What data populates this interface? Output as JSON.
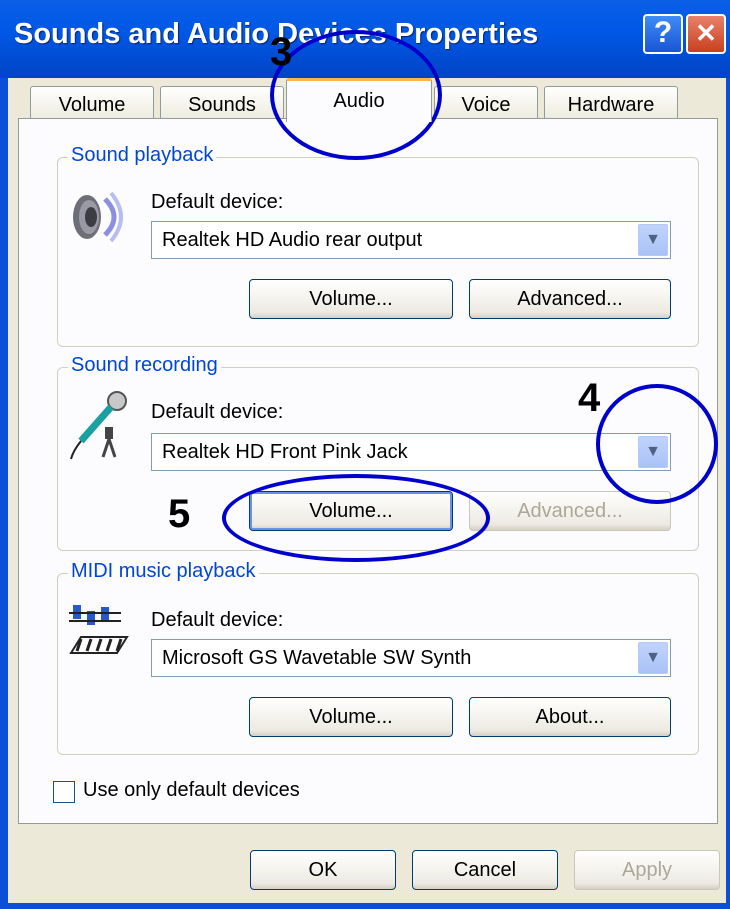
{
  "window": {
    "title": "Sounds and Audio Devices Properties",
    "help_glyph": "?",
    "close_glyph": "✕"
  },
  "tabs": [
    {
      "label": "Volume"
    },
    {
      "label": "Sounds"
    },
    {
      "label": "Audio",
      "active": true
    },
    {
      "label": "Voice"
    },
    {
      "label": "Hardware"
    }
  ],
  "playback": {
    "group_label": "Sound playback",
    "device_label": "Default device:",
    "device_value": "Realtek HD Audio rear output",
    "volume_button": "Volume...",
    "advanced_button": "Advanced..."
  },
  "recording": {
    "group_label": "Sound recording",
    "device_label": "Default device:",
    "device_value": "Realtek HD Front Pink Jack",
    "volume_button": "Volume...",
    "advanced_button": "Advanced..."
  },
  "midi": {
    "group_label": "MIDI music playback",
    "device_label": "Default device:",
    "device_value": "Microsoft GS Wavetable SW Synth",
    "volume_button": "Volume...",
    "about_button": "About..."
  },
  "checkbox_label": "Use only default devices",
  "footer": {
    "ok": "OK",
    "cancel": "Cancel",
    "apply": "Apply"
  },
  "annotations": {
    "n3": "3",
    "n4": "4",
    "n5": "5",
    "color": "#0000cc"
  },
  "colors": {
    "titlebar": "#0058e6",
    "group_label": "#0046d5",
    "tab_highlight": "#f7b64a"
  }
}
